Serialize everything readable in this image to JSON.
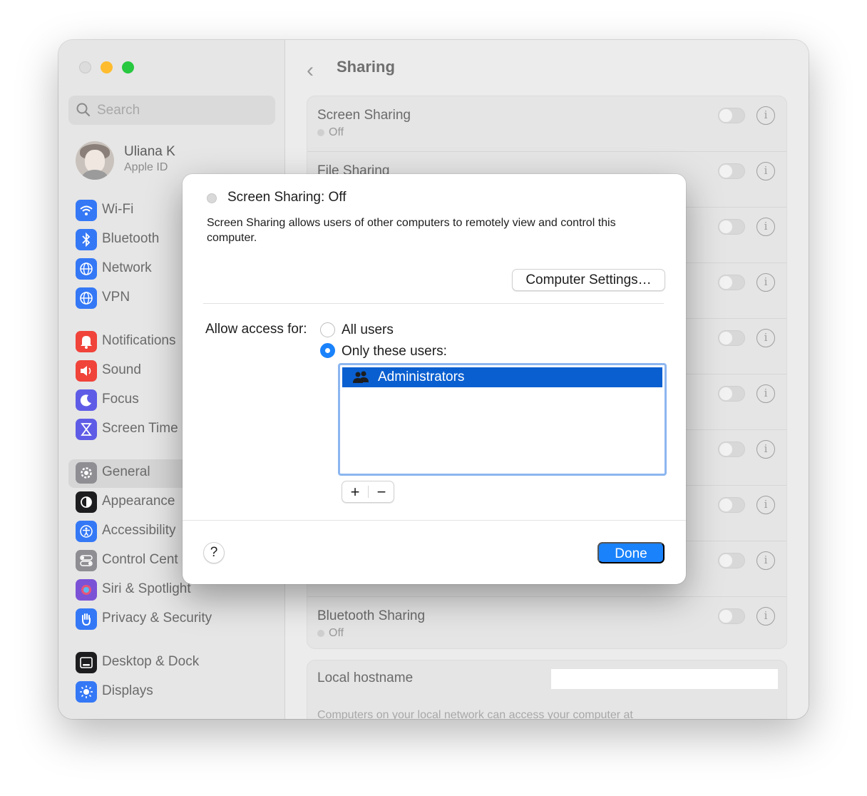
{
  "sidebar": {
    "search_placeholder": "Search",
    "profile": {
      "name": "Uliana K",
      "subtitle": "Apple ID"
    },
    "items": [
      {
        "label": "Wi-Fi",
        "icon": "wifi-icon",
        "color": "#3478f6"
      },
      {
        "label": "Bluetooth",
        "icon": "bluetooth-icon",
        "color": "#3478f6"
      },
      {
        "label": "Network",
        "icon": "globe-icon",
        "color": "#3478f6"
      },
      {
        "label": "VPN",
        "icon": "vpn-globe-icon",
        "color": "#3478f6"
      },
      {
        "label": "Notifications",
        "icon": "bell-icon",
        "color": "#f0433a"
      },
      {
        "label": "Sound",
        "icon": "speaker-icon",
        "color": "#f0433a"
      },
      {
        "label": "Focus",
        "icon": "moon-icon",
        "color": "#5e5ce6"
      },
      {
        "label": "Screen Time",
        "icon": "hourglass-icon",
        "color": "#5e5ce6"
      },
      {
        "label": "General",
        "icon": "gear-icon",
        "color": "#8e8e93"
      },
      {
        "label": "Appearance",
        "icon": "appearance-icon",
        "color": "#1d1d1f"
      },
      {
        "label": "Accessibility",
        "icon": "accessibility-icon",
        "color": "#3478f6"
      },
      {
        "label": "Control Cent",
        "icon": "control-center-icon",
        "color": "#8e8e93"
      },
      {
        "label": "Siri & Spotlight",
        "icon": "siri-icon",
        "color": "#7b52d6"
      },
      {
        "label": "Privacy & Security",
        "icon": "hand-icon",
        "color": "#3478f6"
      },
      {
        "label": "Desktop & Dock",
        "icon": "dock-icon",
        "color": "#1d1d1f"
      },
      {
        "label": "Displays",
        "icon": "sun-icon",
        "color": "#3478f6"
      }
    ]
  },
  "main": {
    "title": "Sharing",
    "rows": [
      {
        "title": "Screen Sharing",
        "status": "Off"
      },
      {
        "title": "File Sharing",
        "status": ""
      },
      {
        "title": "Bluetooth Sharing",
        "status": "Off"
      }
    ],
    "hostname": {
      "label": "Local hostname",
      "description": "Computers on your local network can access your computer at"
    }
  },
  "sheet": {
    "title": "Screen Sharing: Off",
    "description": "Screen Sharing allows users of other computers to remotely view and control this computer.",
    "computer_settings_button": "Computer Settings…",
    "allow_access_label": "Allow access for:",
    "options": [
      "All users",
      "Only these users:"
    ],
    "selected_option": "Only these users:",
    "users": [
      "Administrators"
    ],
    "add_button": "+",
    "remove_button": "−",
    "help_button": "?",
    "done_button": "Done",
    "accent_color": "#1a82fb"
  }
}
